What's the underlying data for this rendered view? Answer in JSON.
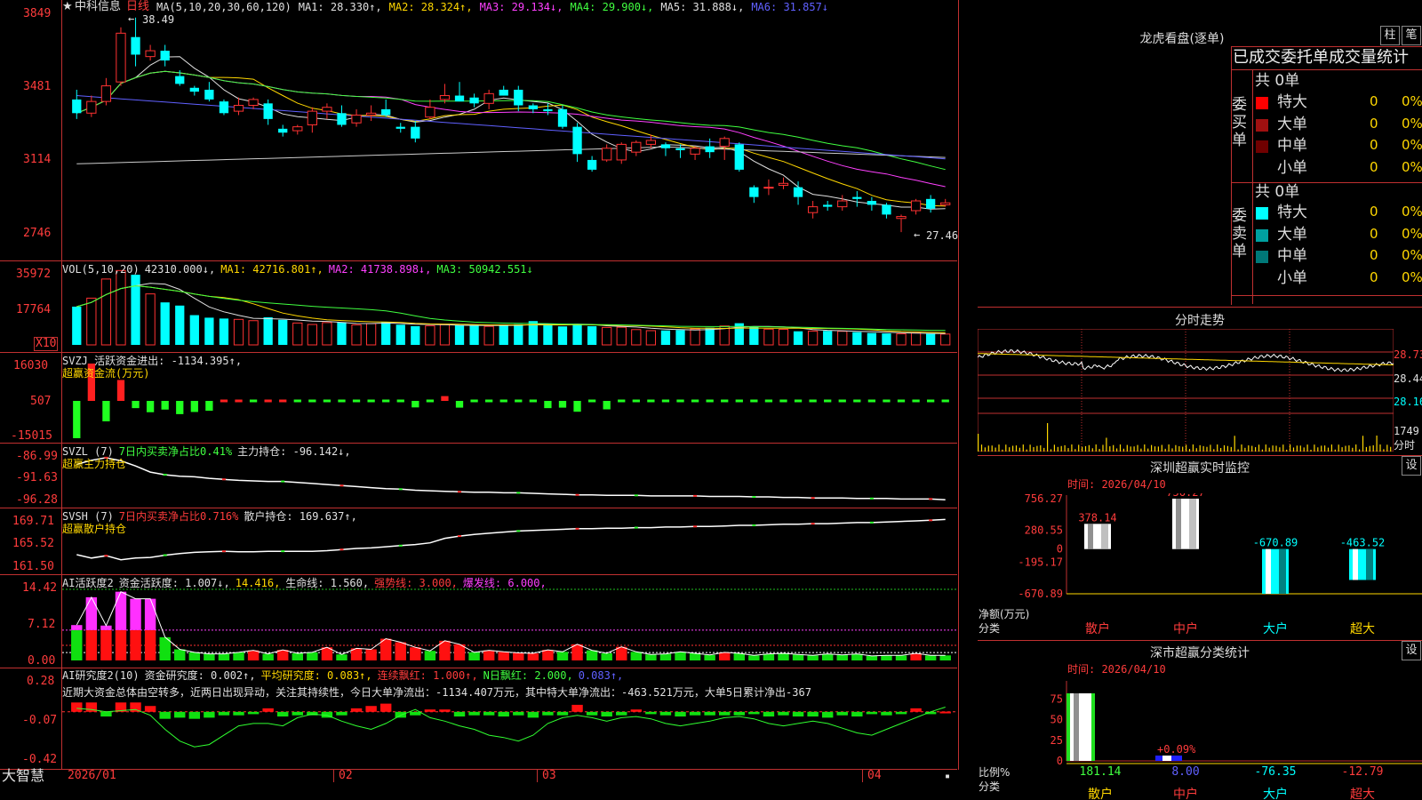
{
  "stock": {
    "star": "★",
    "name": "中科信息",
    "period": "日线"
  },
  "main_chart": {
    "ma_header": [
      {
        "t": "MA(5,10,20,30,60,120)",
        "c": "white"
      },
      {
        "t": "MA1: 28.330↑,",
        "c": "white"
      },
      {
        "t": "MA2: 28.324↑,",
        "c": "yellow"
      },
      {
        "t": "MA3: 29.134↓,",
        "c": "magenta"
      },
      {
        "t": "MA4: 29.900↓,",
        "c": "green"
      },
      {
        "t": "MA5: 31.888↓,",
        "c": "white"
      },
      {
        "t": "MA6: 31.857↓",
        "c": "blue"
      }
    ],
    "y_ticks": [
      "3849",
      "3481",
      "3114",
      "2746"
    ],
    "high_label": "38.49",
    "low_label": "27.46"
  },
  "vol": {
    "header": [
      {
        "t": "VOL(5,10,20)",
        "c": "white"
      },
      {
        "t": "42310.000↓,",
        "c": "white"
      },
      {
        "t": "MA1: 42716.801↑,",
        "c": "yellow"
      },
      {
        "t": "MA2: 41738.898↓,",
        "c": "magenta"
      },
      {
        "t": "MA3: 50942.551↓",
        "c": "green"
      }
    ],
    "y_ticks": [
      "35972",
      "17764"
    ],
    "unit": "X10"
  },
  "svzj": {
    "title": "SVZJ 活跃资金进出: -1134.395↑,",
    "sub": "超赢资金流(万元)",
    "y_ticks": [
      "16030",
      "507",
      "-15015"
    ]
  },
  "svzl": {
    "header": [
      {
        "t": "SVZL (7)",
        "c": "white"
      },
      {
        "t": "7日内买卖净占比0.41%",
        "c": "green"
      },
      {
        "t": "主力持仓: -96.142↓,",
        "c": "white"
      }
    ],
    "sub": "超赢主力持仓",
    "y_ticks": [
      "-86.99",
      "-91.63",
      "-96.28"
    ]
  },
  "svsh": {
    "header": [
      {
        "t": "SVSH (7)",
        "c": "white"
      },
      {
        "t": "7日内买卖净占比0.716%",
        "c": "red"
      },
      {
        "t": "散户持仓: 169.637↑,",
        "c": "white"
      }
    ],
    "sub": "超赢散户持仓",
    "y_ticks": [
      "169.71",
      "165.52",
      "161.50"
    ]
  },
  "ai_active": {
    "header": [
      {
        "t": "AI活跃度2",
        "c": "white"
      },
      {
        "t": "资金活跃度: 1.007↓,",
        "c": "white"
      },
      {
        "t": "14.416,",
        "c": "yellow"
      },
      {
        "t": "生命线: 1.560,",
        "c": "white"
      },
      {
        "t": "强势线: 3.000,",
        "c": "red"
      },
      {
        "t": "爆发线: 6.000,",
        "c": "magenta"
      }
    ],
    "y_ticks": [
      "14.42",
      "7.12",
      "0.00"
    ]
  },
  "ai_research": {
    "header": [
      {
        "t": "AI研究度2(10)",
        "c": "white"
      },
      {
        "t": "资金研究度: 0.002↑,",
        "c": "white"
      },
      {
        "t": "平均研究度: 0.083↑,",
        "c": "yellow"
      },
      {
        "t": "连续飘红: 1.000↑,",
        "c": "red"
      },
      {
        "t": "N日飘红: 2.000,",
        "c": "green"
      },
      {
        "t": "0.083↑,",
        "c": "blue"
      }
    ],
    "commentary": "近期大资金总体由空转多，近两日出现异动，关注其持续性，今日大单净流出：-1134.407万元，其中特大单净流出：-463.521万元，大单5日累计净出-367",
    "y_ticks": [
      "0.28",
      "-0.07",
      "-0.42"
    ]
  },
  "x_axis": [
    "2026/01",
    "02",
    "03",
    "04"
  ],
  "brand": "大智慧",
  "dragon_tiger": {
    "title": "龙虎看盘(逐单)",
    "btn_bar": "柱",
    "btn_pen": "笔",
    "tabs": "已成交委托单成交量统计",
    "buy": {
      "label": "委买单",
      "total": "共 0单",
      "rows": [
        {
          "name": "特大",
          "count": "0",
          "pct": "0%",
          "color": "#ff0000"
        },
        {
          "name": "大单",
          "count": "0",
          "pct": "0%",
          "color": "#a01010"
        },
        {
          "name": "中单",
          "count": "0",
          "pct": "0%",
          "color": "#700000"
        },
        {
          "name": "小单",
          "count": "0",
          "pct": "0%",
          "color": "#000000"
        }
      ]
    },
    "sell": {
      "label": "委卖单",
      "total": "共 0单",
      "rows": [
        {
          "name": "特大",
          "count": "0",
          "pct": "0%",
          "color": "#00ffff"
        },
        {
          "name": "大单",
          "count": "0",
          "pct": "0%",
          "color": "#00a0a0"
        },
        {
          "name": "中单",
          "count": "0",
          "pct": "0%",
          "color": "#007878"
        },
        {
          "name": "小单",
          "count": "0",
          "pct": "0%",
          "color": "#000000"
        }
      ]
    }
  },
  "intraday": {
    "title": "分时走势",
    "y_ticks": [
      "28.73",
      "28.44",
      "28.16"
    ],
    "vol_tick": "1749",
    "vol_label": "分时"
  },
  "sz_monitor": {
    "title": "深圳超赢实时监控",
    "settings": "设",
    "time": "时间: 2026/04/10",
    "y_ticks": [
      "756.27",
      "280.55",
      "0",
      "-195.17",
      "-670.89"
    ],
    "ylabel": "净额(万元)",
    "xlabel": "分类"
  },
  "sz_class": {
    "title": "深市超赢分类统计",
    "settings": "设",
    "time": "时间: 2026/04/10",
    "y_ticks": [
      "75",
      "50",
      "25",
      "0"
    ],
    "ylabel": "比例%",
    "xlabel": "分类"
  },
  "chart_data": [
    {
      "type": "candlestick",
      "title": "中科信息 日线",
      "ylim": [
        27.46,
        38.49
      ],
      "x_range": [
        "2026/01",
        "2026/04/10"
      ],
      "ohlc": [
        [
          34.3,
          34.8,
          33.3,
          33.6
        ],
        [
          33.6,
          34.5,
          33.4,
          34.2
        ],
        [
          34.2,
          35.4,
          34.0,
          35.0
        ],
        [
          35.2,
          38.0,
          35.0,
          37.7
        ],
        [
          37.5,
          38.5,
          36.0,
          36.6
        ],
        [
          36.5,
          37.1,
          36.3,
          36.8
        ],
        [
          36.8,
          37.1,
          36.0,
          36.3
        ],
        [
          35.5,
          35.8,
          35.0,
          35.1
        ],
        [
          34.9,
          35.0,
          34.5,
          34.7
        ],
        [
          34.8,
          35.2,
          34.2,
          34.3
        ],
        [
          34.2,
          34.3,
          33.5,
          33.6
        ],
        [
          33.7,
          34.4,
          33.5,
          34.0
        ],
        [
          34.0,
          34.4,
          33.8,
          34.3
        ],
        [
          34.1,
          34.3,
          33.0,
          33.3
        ],
        [
          32.8,
          33.0,
          32.4,
          32.6
        ],
        [
          32.7,
          33.0,
          32.5,
          32.9
        ],
        [
          33.0,
          33.9,
          32.6,
          33.7
        ],
        [
          33.7,
          34.1,
          33.3,
          33.9
        ],
        [
          33.6,
          34.0,
          32.9,
          33.0
        ],
        [
          33.1,
          33.8,
          32.9,
          33.5
        ],
        [
          33.5,
          34.0,
          33.2,
          33.6
        ],
        [
          33.8,
          34.3,
          33.4,
          33.5
        ],
        [
          32.9,
          33.1,
          32.6,
          32.8
        ],
        [
          32.9,
          33.2,
          32.1,
          32.3
        ],
        [
          33.4,
          34.3,
          33.3,
          33.9
        ],
        [
          34.3,
          35.1,
          34.1,
          34.5
        ],
        [
          34.5,
          35.2,
          34.2,
          34.2
        ],
        [
          34.4,
          34.6,
          33.9,
          34.1
        ],
        [
          34.1,
          34.8,
          33.8,
          34.6
        ],
        [
          34.8,
          35.0,
          34.5,
          34.5
        ],
        [
          34.8,
          35.0,
          33.7,
          34.0
        ],
        [
          34.0,
          34.1,
          33.6,
          33.8
        ],
        [
          33.8,
          34.1,
          33.5,
          33.7
        ],
        [
          33.8,
          34.0,
          32.8,
          32.9
        ],
        [
          32.9,
          33.1,
          31.1,
          31.5
        ],
        [
          31.2,
          31.4,
          30.6,
          30.7
        ],
        [
          31.2,
          32.0,
          31.1,
          31.8
        ],
        [
          31.2,
          32.1,
          31.0,
          32.0
        ],
        [
          31.6,
          32.2,
          31.4,
          32.1
        ],
        [
          32.0,
          32.5,
          31.8,
          32.2
        ],
        [
          32.0,
          32.1,
          31.4,
          31.8
        ],
        [
          31.8,
          32.0,
          31.3,
          31.7
        ],
        [
          31.5,
          31.9,
          31.2,
          31.8
        ],
        [
          31.9,
          32.3,
          31.3,
          31.6
        ],
        [
          31.9,
          32.4,
          31.2,
          32.3
        ],
        [
          32.0,
          32.1,
          30.6,
          30.7
        ],
        [
          29.8,
          29.9,
          29.0,
          29.3
        ],
        [
          29.8,
          30.2,
          29.4,
          29.8
        ],
        [
          29.9,
          30.3,
          29.7,
          30.0
        ],
        [
          29.8,
          30.1,
          28.9,
          29.3
        ],
        [
          28.5,
          29.1,
          28.2,
          28.8
        ],
        [
          28.9,
          29.1,
          28.6,
          28.8
        ],
        [
          28.8,
          29.4,
          28.6,
          29.1
        ],
        [
          29.3,
          29.6,
          28.8,
          29.2
        ],
        [
          29.1,
          29.3,
          28.6,
          28.9
        ],
        [
          28.9,
          29.0,
          28.2,
          28.4
        ],
        [
          28.2,
          28.4,
          27.5,
          28.3
        ],
        [
          28.6,
          29.2,
          28.4,
          29.1
        ],
        [
          29.2,
          29.4,
          28.5,
          28.7
        ],
        [
          28.9,
          29.2,
          28.8,
          29.0
        ]
      ]
    },
    {
      "type": "bar",
      "title": "VOL(5,10,20)",
      "ylim": [
        0,
        35972
      ],
      "values": [
        18000,
        22000,
        31000,
        35000,
        33000,
        24000,
        20000,
        18500,
        14000,
        12800,
        12400,
        12000,
        11400,
        13000,
        11800,
        10300,
        9600,
        10500,
        10700,
        9400,
        10000,
        10800,
        9500,
        8800,
        9000,
        9500,
        9400,
        9200,
        8700,
        9100,
        9700,
        11200,
        9700,
        8700,
        9600,
        8800,
        8200,
        8300,
        7200,
        6700,
        6800,
        7000,
        7500,
        8100,
        8900,
        10200,
        8600,
        7400,
        7300,
        6400,
        6500,
        6600,
        6400,
        6000,
        5600,
        5400,
        5200,
        5600,
        5200,
        5100
      ]
    },
    {
      "type": "bar",
      "title": "超赢资金流(万元)",
      "ylim": [
        -15015,
        16030
      ],
      "values": [
        -15015,
        16030,
        -8000,
        9200,
        -2500,
        -4200,
        -3100,
        -5000,
        -4100,
        -3600,
        1200,
        800,
        -2000,
        800,
        600,
        -1500,
        -1800,
        -1500,
        -1200,
        -1700,
        -1600,
        -1300,
        -900,
        -2200,
        -2000,
        2500,
        -2300,
        -1500,
        -1800,
        -1600,
        -1200,
        -1900,
        -2500,
        -2300,
        -4000,
        -1700,
        -3000,
        -1500,
        -1700,
        -1300,
        -1400,
        -1100,
        -1600,
        -1800,
        -1200,
        -1800,
        -1100,
        -1800,
        -1400,
        -1600,
        -1100,
        -1500,
        -900,
        -1500,
        -1000,
        -1200,
        -1100,
        -1000,
        -1500,
        -1134
      ]
    },
    {
      "type": "line",
      "title": "超赢主力持仓",
      "ylim": [
        -96.28,
        -86.99
      ],
      "values": [
        -89.3,
        -88.5,
        -88.0,
        -88.6,
        -89.6,
        -90.8,
        -91.3,
        -91.6,
        -91.7,
        -92.0,
        -92.2,
        -92.4,
        -92.5,
        -92.6,
        -92.6,
        -92.8,
        -93.0,
        -93.2,
        -93.4,
        -93.6,
        -93.8,
        -94.0,
        -94.1,
        -94.3,
        -94.4,
        -94.5,
        -94.6,
        -94.7,
        -94.7,
        -94.8,
        -94.8,
        -94.9,
        -95.0,
        -95.1,
        -95.2,
        -95.2,
        -95.3,
        -95.3,
        -95.3,
        -95.4,
        -95.4,
        -95.4,
        -95.4,
        -95.5,
        -95.5,
        -95.5,
        -95.6,
        -95.6,
        -95.7,
        -95.7,
        -95.8,
        -95.8,
        -95.8,
        -95.9,
        -95.9,
        -95.9,
        -96.0,
        -96.0,
        -96.0,
        -96.14
      ]
    },
    {
      "type": "line",
      "title": "超赢散户持仓",
      "ylim": [
        161.5,
        169.71
      ],
      "values": [
        163.4,
        162.8,
        163.2,
        162.5,
        162.8,
        162.9,
        163.3,
        163.6,
        163.8,
        163.9,
        164.0,
        163.9,
        163.9,
        164.0,
        164.0,
        164.0,
        164.0,
        164.1,
        164.3,
        164.5,
        164.6,
        164.8,
        165.0,
        165.2,
        165.5,
        166.3,
        166.7,
        167.0,
        167.2,
        167.4,
        167.6,
        167.7,
        167.8,
        167.9,
        168.0,
        168.0,
        168.1,
        168.1,
        168.2,
        168.2,
        168.3,
        168.3,
        168.4,
        168.4,
        168.5,
        168.6,
        168.6,
        168.7,
        168.8,
        168.8,
        168.9,
        168.9,
        169.0,
        169.1,
        169.1,
        169.2,
        169.3,
        169.4,
        169.5,
        169.64
      ]
    },
    {
      "type": "bar",
      "title": "AI活跃度2",
      "ylim": [
        0,
        14.42
      ],
      "values": [
        7.0,
        12.5,
        6.9,
        13.6,
        12.2,
        12.2,
        4.6,
        2.2,
        1.6,
        1.3,
        1.3,
        1.6,
        2.0,
        1.3,
        2.1,
        1.4,
        1.6,
        2.6,
        1.2,
        2.4,
        2.2,
        4.3,
        3.6,
        2.6,
        1.9,
        3.9,
        3.2,
        1.6,
        2.0,
        1.7,
        1.5,
        1.4,
        2.1,
        1.7,
        3.2,
        2.0,
        1.4,
        2.7,
        1.7,
        1.2,
        1.3,
        1.7,
        1.4,
        1.1,
        1.6,
        1.4,
        1.0,
        1.3,
        1.4,
        1.2,
        1.0,
        1.3,
        1.1,
        1.3,
        0.9,
        1.0,
        1.0,
        1.4,
        1.0,
        1.0
      ],
      "color_series": [
        "g",
        "r",
        "r",
        "r",
        "r",
        "r",
        "g",
        "g",
        "g",
        "g",
        "g",
        "g",
        "r",
        "g",
        "r",
        "g",
        "g",
        "r",
        "g",
        "r",
        "r",
        "r",
        "r",
        "r",
        "g",
        "r",
        "r",
        "g",
        "r",
        "r",
        "r",
        "r",
        "r",
        "g",
        "r",
        "g",
        "g",
        "r",
        "g",
        "g",
        "g",
        "g",
        "g",
        "g",
        "r",
        "g",
        "g",
        "g",
        "g",
        "g",
        "g",
        "g",
        "g",
        "g",
        "g",
        "g",
        "g",
        "r",
        "g",
        "g"
      ]
    },
    {
      "type": "bar",
      "title": "AI研究度2(10)",
      "ylim": [
        -0.42,
        0.28
      ],
      "values": [
        0.08,
        0.08,
        -0.04,
        0.08,
        0.08,
        0.05,
        -0.06,
        -0.05,
        -0.06,
        -0.05,
        -0.03,
        -0.03,
        -0.02,
        0.03,
        -0.04,
        -0.03,
        -0.03,
        -0.05,
        -0.03,
        0.03,
        0.05,
        0.07,
        -0.05,
        -0.03,
        0.02,
        0.02,
        -0.04,
        -0.03,
        -0.03,
        -0.04,
        -0.03,
        -0.05,
        -0.03,
        -0.03,
        0.06,
        -0.03,
        -0.04,
        -0.03,
        0.02,
        -0.02,
        -0.03,
        -0.04,
        -0.03,
        -0.03,
        -0.03,
        -0.03,
        -0.02,
        -0.04,
        -0.03,
        -0.04,
        -0.04,
        -0.05,
        -0.03,
        -0.04,
        -0.02,
        -0.03,
        -0.02,
        0.03,
        -0.02,
        0.002
      ]
    },
    {
      "type": "bar",
      "title": "深圳超赢实时监控",
      "categories": [
        "散户",
        "中户",
        "大户",
        "超大"
      ],
      "values": [
        378.14,
        756.27,
        -670.89,
        -463.52
      ],
      "ylim": [
        -670.89,
        756.27
      ],
      "ylabel": "净额(万元)",
      "xlabel": "分类"
    },
    {
      "type": "bar",
      "title": "深市超赢分类统计",
      "categories": [
        "散户",
        "中户",
        "大户",
        "超大"
      ],
      "values": [
        181.14,
        8.0,
        -76.35,
        -12.79
      ],
      "annotation": "+0.09%",
      "ylim": [
        0,
        75
      ],
      "ylabel": "比例%",
      "xlabel": "分类"
    }
  ]
}
